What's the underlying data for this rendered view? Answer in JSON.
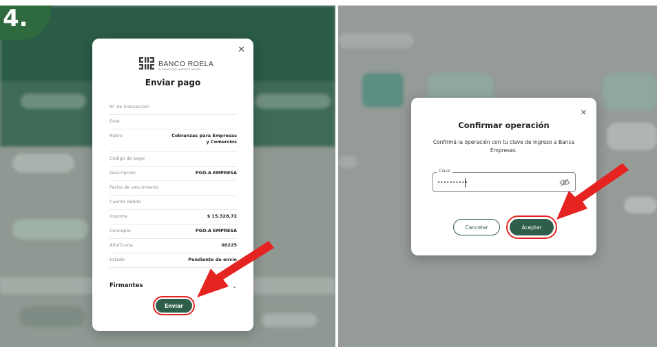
{
  "step_badge": {
    "number": "4."
  },
  "payment_modal": {
    "bank_name": "BANCO ROELA",
    "bank_tagline": "EL BANCO QUE HACEMOS JUNTOS",
    "title": "Enviar pago",
    "rows": [
      {
        "label": "N° de transacción",
        "value": ""
      },
      {
        "label": "Ente",
        "value": ""
      },
      {
        "label": "Rubro",
        "value": "Cobranzas para Empresas\ny Comercios"
      },
      {
        "label": "Código de pago",
        "value": ""
      },
      {
        "label": "Descripción",
        "value": "PGO.A EMPRESA"
      },
      {
        "label": "Fecha de vencimiento",
        "value": ""
      },
      {
        "label": "Cuenta débito",
        "value": ""
      },
      {
        "label": "Importe",
        "value": "$ 15.328,72"
      },
      {
        "label": "Concepto",
        "value": "PGO.A EMPRESA"
      },
      {
        "label": "Año/Cuota",
        "value": "00225"
      },
      {
        "label": "Estado",
        "value": "Pendiente de envío"
      }
    ],
    "firmantes_label": "Firmantes",
    "send_button": "Enviar"
  },
  "confirm_modal": {
    "title": "Confirmar operación",
    "message": "Confirmá la operación con tu clave de ingreso a Banca Empresas.",
    "field_label": "Clave",
    "password_value": "••••••••••",
    "cancel_button": "Cancelar",
    "accept_button": "Aceptar"
  },
  "icons": {
    "close": "close-icon",
    "chevron": "chevron-down-icon",
    "eye": "eye-off-icon",
    "logo": "bank-logo-icon",
    "arrow": "red-arrow-icon"
  },
  "colors": {
    "primary_green": "#2f5e4a",
    "badge_green": "#2e6a3d",
    "highlight_red": "#e52421"
  }
}
